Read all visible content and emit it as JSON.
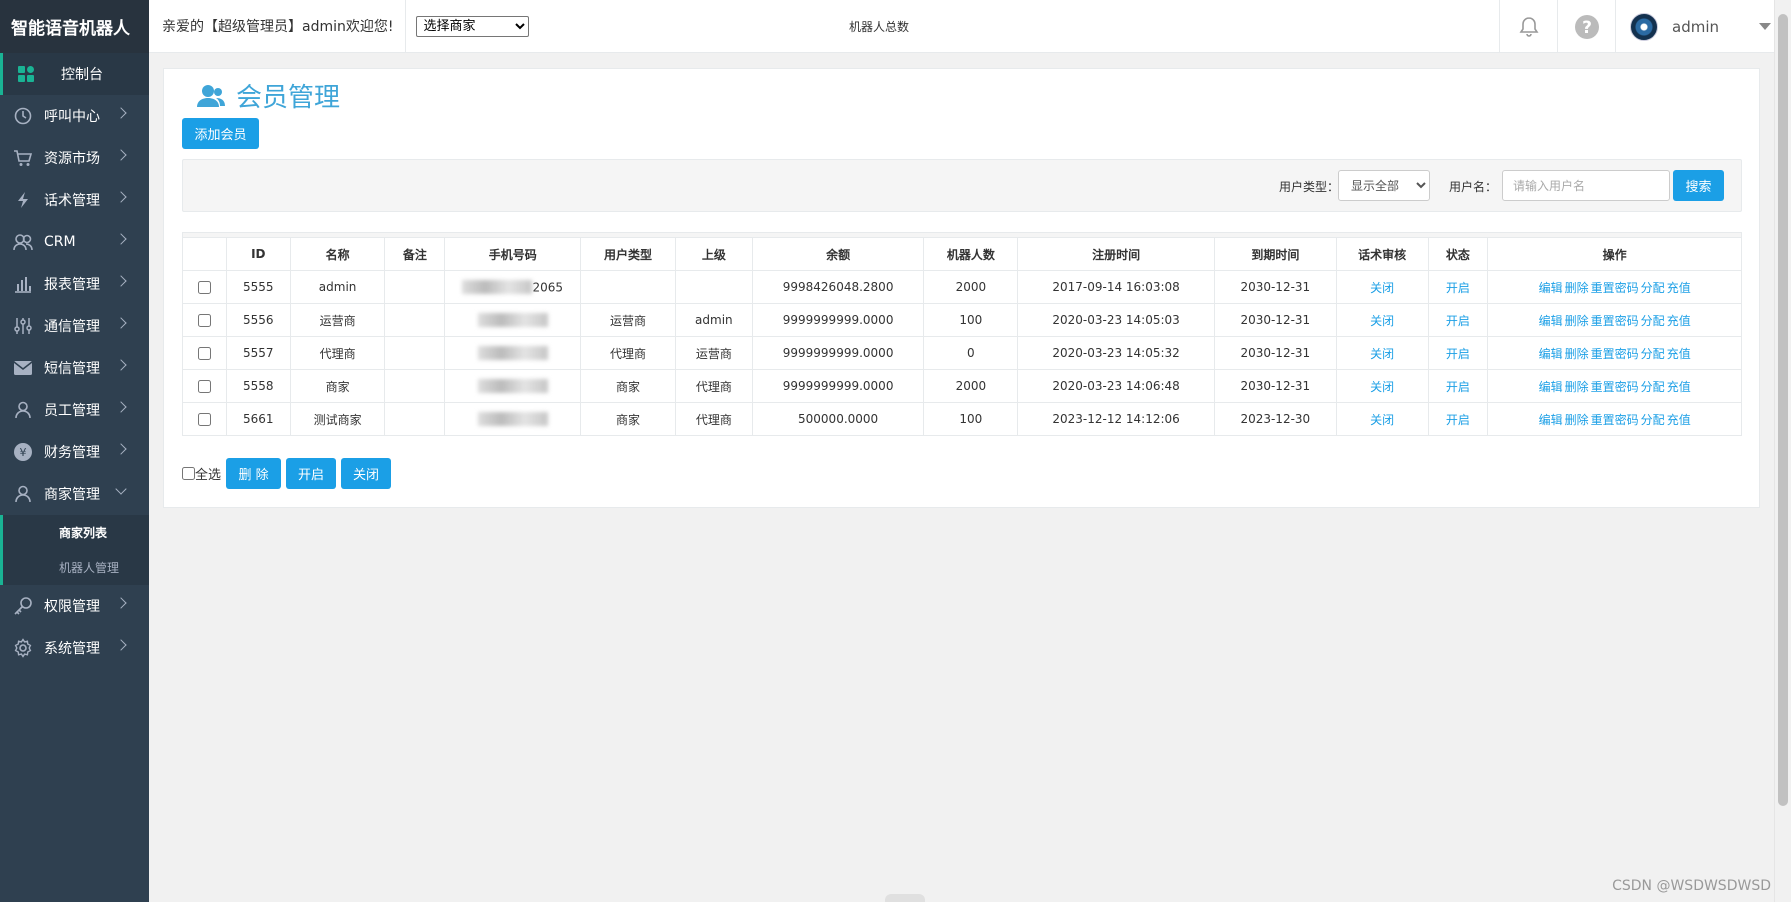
{
  "brand": "智能语音机器人",
  "sidebar": {
    "items": [
      {
        "label": "控制台",
        "icon": "dashboard-icon"
      },
      {
        "label": "呼叫中心",
        "icon": "clock-icon"
      },
      {
        "label": "资源市场",
        "icon": "cart-icon"
      },
      {
        "label": "话术管理",
        "icon": "bolt-icon"
      },
      {
        "label": "CRM",
        "icon": "users-icon"
      },
      {
        "label": "报表管理",
        "icon": "bar-chart-icon"
      },
      {
        "label": "通信管理",
        "icon": "sliders-icon"
      },
      {
        "label": "短信管理",
        "icon": "envelope-icon"
      },
      {
        "label": "员工管理",
        "icon": "user-icon"
      },
      {
        "label": "财务管理",
        "icon": "yen-icon"
      },
      {
        "label": "商家管理",
        "icon": "merchant-icon"
      },
      {
        "label": "权限管理",
        "icon": "key-icon"
      },
      {
        "label": "系统管理",
        "icon": "gear-icon"
      }
    ],
    "submenu": [
      {
        "label": "商家列表"
      },
      {
        "label": "机器人管理"
      }
    ]
  },
  "topbar": {
    "welcome": "亲爱的【超级管理员】admin欢迎您!",
    "merchant_select": "选择商家",
    "robot_total": "机器人总数",
    "user_name": "admin"
  },
  "page": {
    "title": "会员管理",
    "add_button": "添加会员",
    "filter": {
      "type_label": "用户类型：",
      "type_selected": "显示全部",
      "name_label": "用户名：",
      "name_placeholder": "请输入用户名",
      "search_button": "搜索"
    },
    "columns": [
      "ID",
      "名称",
      "备注",
      "手机号码",
      "用户类型",
      "上级",
      "余额",
      "机器人数",
      "注册时间",
      "到期时间",
      "话术审核",
      "状态",
      "操作"
    ],
    "rows": [
      {
        "id": "5555",
        "name": "admin",
        "note": "",
        "phone": "2065",
        "type": "",
        "parent": "",
        "balance": "9998426048.2800",
        "robots": "2000",
        "registered": "2017-09-14 16:03:08",
        "expires": "2030-12-31",
        "review": "关闭",
        "status": "开启"
      },
      {
        "id": "5556",
        "name": "运营商",
        "note": "",
        "phone": "",
        "type": "运营商",
        "parent": "admin",
        "balance": "9999999999.0000",
        "robots": "100",
        "registered": "2020-03-23 14:05:03",
        "expires": "2030-12-31",
        "review": "关闭",
        "status": "开启"
      },
      {
        "id": "5557",
        "name": "代理商",
        "note": "",
        "phone": "",
        "type": "代理商",
        "parent": "运营商",
        "balance": "9999999999.0000",
        "robots": "0",
        "registered": "2020-03-23 14:05:32",
        "expires": "2030-12-31",
        "review": "关闭",
        "status": "开启"
      },
      {
        "id": "5558",
        "name": "商家",
        "note": "",
        "phone": "",
        "type": "商家",
        "parent": "代理商",
        "balance": "9999999999.0000",
        "robots": "2000",
        "registered": "2020-03-23 14:06:48",
        "expires": "2030-12-31",
        "review": "关闭",
        "status": "开启"
      },
      {
        "id": "5661",
        "name": "测试商家",
        "note": "",
        "phone": "",
        "type": "商家",
        "parent": "代理商",
        "balance": "500000.0000",
        "robots": "100",
        "registered": "2023-12-12 14:12:06",
        "expires": "2023-12-30",
        "review": "关闭",
        "status": "开启"
      }
    ],
    "row_actions": [
      "编辑",
      "删除",
      "重置密码",
      "分配",
      "充值"
    ],
    "bottom": {
      "select_all": "全选",
      "delete": "删 除",
      "enable": "开启",
      "disable": "关闭"
    }
  },
  "watermark": "CSDN @WSDWSDWSD",
  "colors": {
    "sidebar": "#2f4050",
    "accent": "#1b9fe6",
    "active": "#1ab394"
  }
}
